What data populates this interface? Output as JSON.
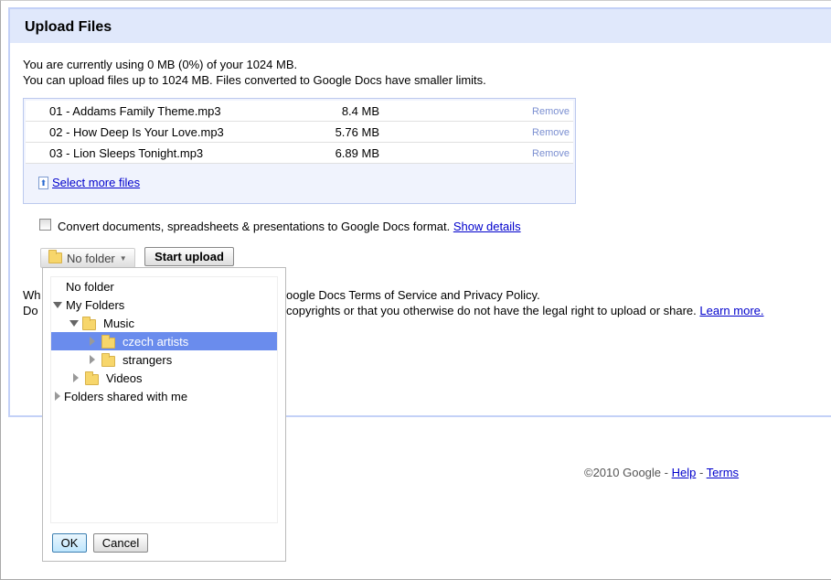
{
  "title": "Upload Files",
  "usage_line": "You are currently using 0 MB (0%) of your 1024 MB.",
  "limit_line": "You can upload files up to 1024 MB. Files converted to Google Docs have smaller limits.",
  "files": [
    {
      "name": "01 - Addams Family Theme.mp3",
      "size": "8.4 MB",
      "remove": "Remove"
    },
    {
      "name": "02 - How Deep Is Your Love.mp3",
      "size": "5.76 MB",
      "remove": "Remove"
    },
    {
      "name": "03 - Lion Sleeps Tonight.mp3",
      "size": "6.89 MB",
      "remove": "Remove"
    }
  ],
  "select_more": "Select more files",
  "convert": {
    "label": "Convert documents, spreadsheets & presentations to Google Docs format.",
    "checked": false,
    "link": "Show details"
  },
  "folder_button": "No folder",
  "start_upload": "Start upload",
  "terms": {
    "line1_left": "Wh",
    "line1_right": "oogle Docs Terms of Service and Privacy Policy.",
    "line2_left": "Do",
    "line2_right": "copyrights or that you otherwise do not have the legal right to upload or share.",
    "learn_more": "Learn more."
  },
  "folder_picker": {
    "items": [
      {
        "label": "No folder"
      },
      {
        "label": "My Folders",
        "state": "expanded"
      },
      {
        "label": "Music",
        "state": "expanded"
      },
      {
        "label": "czech artists",
        "state": "collapsed",
        "selected": true
      },
      {
        "label": "strangers",
        "state": "collapsed"
      },
      {
        "label": "Videos",
        "state": "collapsed"
      },
      {
        "label": "Folders shared with me",
        "state": "collapsed"
      }
    ],
    "ok": "OK",
    "cancel": "Cancel"
  },
  "footer": {
    "copyright": "©2010 Google",
    "sep": " - ",
    "help": "Help",
    "terms": "Terms"
  },
  "colors": {
    "header_bg": "#e0e8fb",
    "selection": "#6a8ced",
    "link": "#0000cc",
    "remove": "#7b8fd1"
  }
}
